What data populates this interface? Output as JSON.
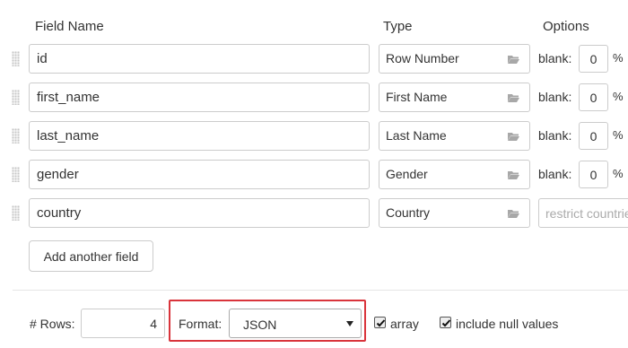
{
  "headers": {
    "field_name": "Field Name",
    "type": "Type",
    "options": "Options"
  },
  "blank_label": "blank:",
  "percent_sign": "%",
  "fields": [
    {
      "name": "id",
      "type": "Row Number",
      "blank": "0"
    },
    {
      "name": "first_name",
      "type": "First Name",
      "blank": "0"
    },
    {
      "name": "last_name",
      "type": "Last Name",
      "blank": "0"
    },
    {
      "name": "gender",
      "type": "Gender",
      "blank": "0"
    },
    {
      "name": "country",
      "type": "Country",
      "restrict_placeholder": "restrict countries"
    }
  ],
  "add_field_button": "Add another field",
  "rows": {
    "label": "# Rows:",
    "value": "4"
  },
  "format": {
    "label": "Format:",
    "selected": "JSON"
  },
  "options": {
    "array_label": "array",
    "array_checked": true,
    "include_null_label": "include null values",
    "include_null_checked": true
  },
  "icons": {
    "type_picker": "folder-open-icon",
    "drag_handle": "drag-handle-icon",
    "dropdown": "caret-down-icon",
    "checkbox": "checkmark-icon"
  },
  "colors": {
    "highlight": "#d9343b",
    "border": "#cccccc",
    "text": "#333333"
  }
}
